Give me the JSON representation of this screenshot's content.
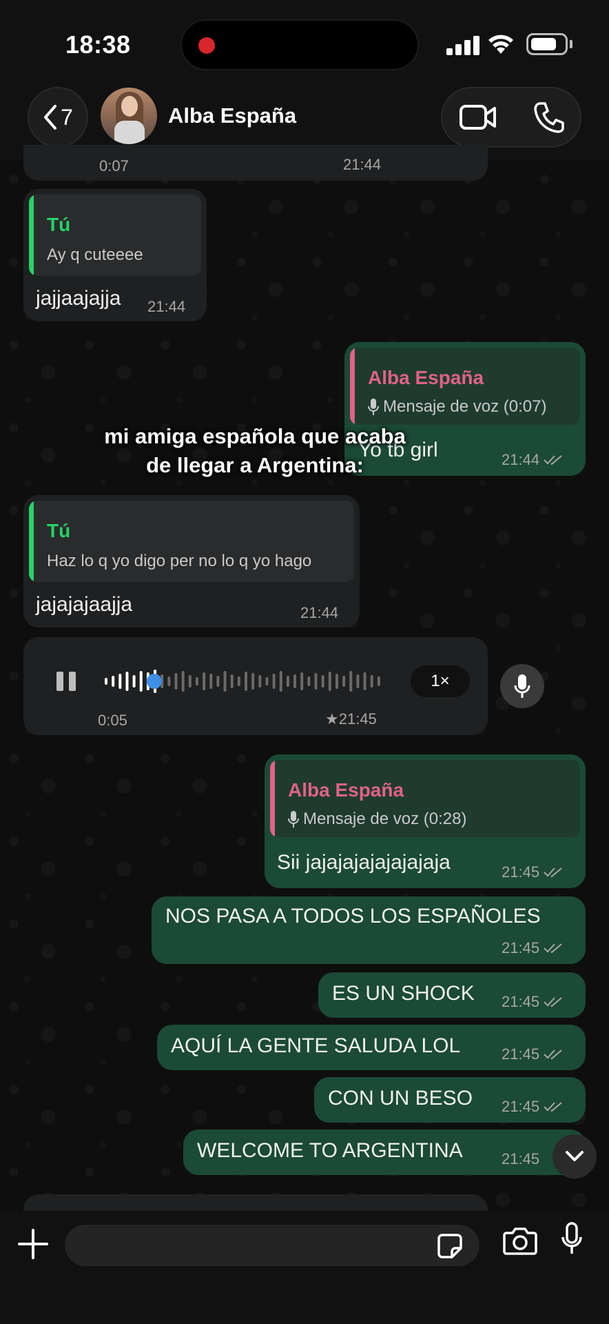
{
  "status_bar": {
    "time": "18:38"
  },
  "header": {
    "back_count": "7",
    "contact_name": "Alba España"
  },
  "messages": {
    "top_partial": {
      "left_time": "0:07",
      "right_time": "21:44"
    },
    "m1": {
      "quote_author": "Tú",
      "quote_text": "Ay q cuteeee",
      "text": "jajjaajajja",
      "time": "21:44"
    },
    "m2": {
      "quote_author": "Alba España",
      "quote_text": "Mensaje de voz (0:07)",
      "text": "Yo tb girl",
      "time": "21:44"
    },
    "m3": {
      "quote_author": "Tú",
      "quote_text": "Haz lo q yo digo per no lo q yo hago",
      "text": "jajajajaajja",
      "time": "21:44"
    },
    "voice": {
      "elapsed": "0:05",
      "time": "★21:45",
      "speed": "1×",
      "progress": 0.18
    },
    "m4": {
      "quote_author": "Alba España",
      "quote_text": "Mensaje de voz (0:28)",
      "text": "Sii jajajajajajajajaja",
      "time": "21:45"
    },
    "m5": {
      "text": "NOS PASA A TODOS LOS ESPAÑOLES",
      "time": "21:45"
    },
    "m6": {
      "text": "ES UN SHOCK",
      "time": "21:45"
    },
    "m7": {
      "text": "AQUÍ LA GENTE SALUDA LOL",
      "time": "21:45"
    },
    "m8": {
      "text": "CON UN BESO",
      "time": "21:45"
    },
    "m9": {
      "text": "WELCOME TO ARGENTINA",
      "time": "21:45"
    }
  },
  "overlay_caption": "mi amiga española que acaba\nde llegar a Argentina:",
  "colors": {
    "outgoing_bubble": "#1b4a36",
    "incoming_bubble": "#1f2021",
    "self_quote_accent": "#25d366",
    "contact_quote_accent": "#e0628a"
  },
  "icons": [
    "chevron-left-icon",
    "video-icon",
    "phone-icon",
    "microphone-icon",
    "pause-icon",
    "plus-icon",
    "sticker-icon",
    "camera-icon",
    "chevron-down-icon",
    "double-check-icon"
  ]
}
